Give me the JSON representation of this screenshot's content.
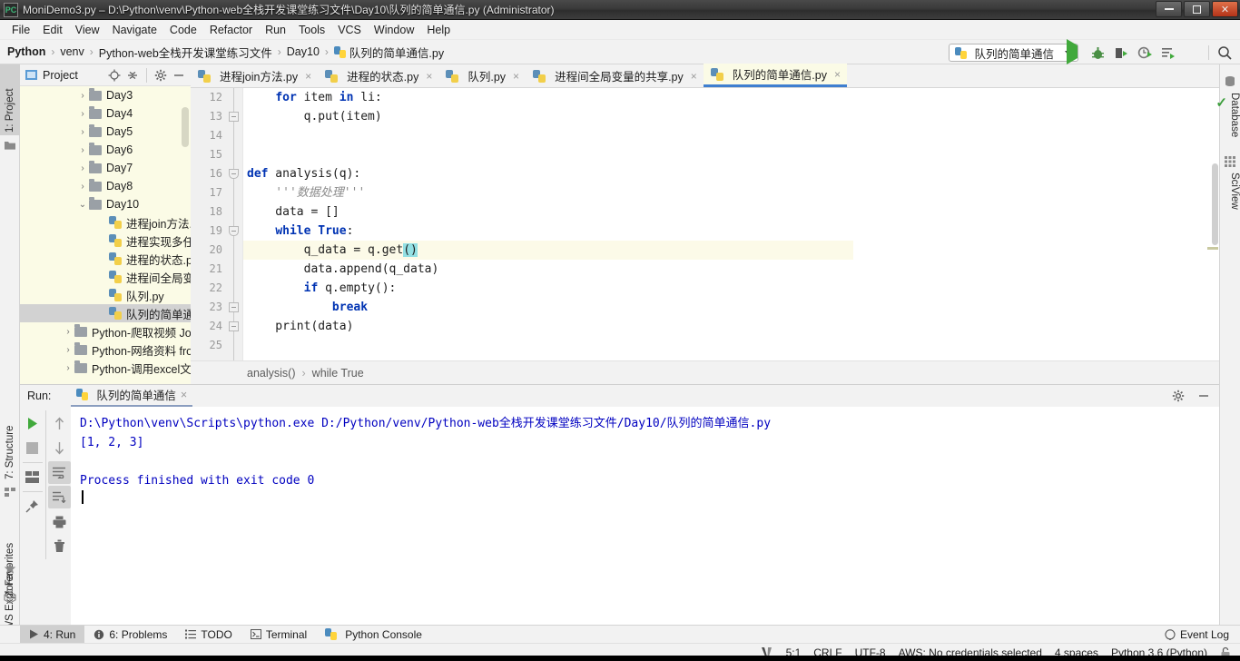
{
  "window": {
    "title": "MoniDemo3.py – D:\\Python\\venv\\Python-web全栈开发课堂练习文件\\Day10\\队列的简单通信.py (Administrator)",
    "app_icon": "PC",
    "minimize": "minimize-icon",
    "restore": "restore-icon",
    "close": "✕"
  },
  "menu": {
    "items": [
      {
        "label": "File"
      },
      {
        "label": "Edit"
      },
      {
        "label": "View"
      },
      {
        "label": "Navigate"
      },
      {
        "label": "Code"
      },
      {
        "label": "Refactor"
      },
      {
        "label": "Run"
      },
      {
        "label": "Tools"
      },
      {
        "label": "VCS"
      },
      {
        "label": "Window"
      },
      {
        "label": "Help"
      }
    ]
  },
  "navbar": {
    "crumbs": [
      "Python",
      "venv",
      "Python-web全栈开发课堂练习文件",
      "Day10",
      "队列的简单通信.py"
    ],
    "separator": "›",
    "run_config": "队列的简单通信",
    "toolbar_icons": [
      "run-icon",
      "debug-icon",
      "run-coverage-icon",
      "profile-icon",
      "run-with-console-icon",
      "stop-icon",
      "search-icon"
    ]
  },
  "project_panel": {
    "title": "Project",
    "header_icons": [
      "locate-icon",
      "collapse-all-icon",
      "settings-icon",
      "hide-icon"
    ],
    "tree": [
      {
        "label": "Day3",
        "type": "folder",
        "indent": 1,
        "arrow": "›",
        "selected": false
      },
      {
        "label": "Day4",
        "type": "folder",
        "indent": 1,
        "arrow": "›",
        "selected": false
      },
      {
        "label": "Day5",
        "type": "folder",
        "indent": 1,
        "arrow": "›",
        "selected": false
      },
      {
        "label": "Day6",
        "type": "folder",
        "indent": 1,
        "arrow": "›",
        "selected": false
      },
      {
        "label": "Day7",
        "type": "folder",
        "indent": 1,
        "arrow": "›",
        "selected": false
      },
      {
        "label": "Day8",
        "type": "folder",
        "indent": 1,
        "arrow": "›",
        "selected": false
      },
      {
        "label": "Day10",
        "type": "folder",
        "indent": 1,
        "arrow": "⌄",
        "selected": false
      },
      {
        "label": "进程join方法.",
        "type": "py",
        "indent": 2,
        "arrow": "",
        "selected": false
      },
      {
        "label": "进程实现多任",
        "type": "py",
        "indent": 2,
        "arrow": "",
        "selected": false
      },
      {
        "label": "进程的状态.py",
        "type": "py",
        "indent": 2,
        "arrow": "",
        "selected": false
      },
      {
        "label": "进程间全局变",
        "type": "py",
        "indent": 2,
        "arrow": "",
        "selected": false
      },
      {
        "label": "队列.py",
        "type": "py",
        "indent": 2,
        "arrow": "",
        "selected": false
      },
      {
        "label": "队列的简单通",
        "type": "py",
        "indent": 2,
        "arrow": "",
        "selected": true
      },
      {
        "label": "Python-爬取视频 Jo",
        "type": "folder",
        "indent": 0,
        "arrow": "›",
        "selected": false
      },
      {
        "label": "Python-网络资料 fro",
        "type": "folder",
        "indent": 0,
        "arrow": "›",
        "selected": false
      },
      {
        "label": "Python-调用excel文",
        "type": "folder",
        "indent": 0,
        "arrow": "›",
        "selected": false
      }
    ]
  },
  "left_strip": {
    "tabs": [
      {
        "label": "1: Project",
        "icon": "project-icon",
        "selected": true
      },
      {
        "label": "7: Structure",
        "icon": "structure-icon",
        "selected": false
      },
      {
        "label": "2: Favorites",
        "icon": "star-icon",
        "selected": false
      },
      {
        "label": "AWS Explorer",
        "icon": "cube-icon",
        "selected": false
      }
    ]
  },
  "right_strip": {
    "tabs": [
      {
        "label": "Database",
        "icon": "database-icon"
      },
      {
        "label": "SciView",
        "icon": "grid-icon"
      }
    ]
  },
  "editor": {
    "tabs": [
      {
        "label": "进程join方法.py",
        "active": false
      },
      {
        "label": "进程的状态.py",
        "active": false
      },
      {
        "label": "队列.py",
        "active": false
      },
      {
        "label": "进程间全局变量的共享.py",
        "active": false
      },
      {
        "label": "队列的简单通信.py",
        "active": true
      }
    ],
    "close_glyph": "×",
    "first_line_number": 12,
    "line_numbers": [
      12,
      13,
      14,
      15,
      16,
      17,
      18,
      19,
      20,
      21,
      22,
      23,
      24,
      25
    ],
    "highlighted_line": 20,
    "code": [
      {
        "n": 12,
        "segments": [
          {
            "t": "    ",
            "c": "pl"
          },
          {
            "t": "for",
            "c": "kw"
          },
          {
            "t": " item ",
            "c": "pl"
          },
          {
            "t": "in",
            "c": "kw"
          },
          {
            "t": " li:",
            "c": "pl"
          }
        ]
      },
      {
        "n": 13,
        "segments": [
          {
            "t": "        q.put(item)",
            "c": "pl"
          }
        ]
      },
      {
        "n": 14,
        "segments": [
          {
            "t": "",
            "c": "pl"
          }
        ]
      },
      {
        "n": 15,
        "segments": [
          {
            "t": "",
            "c": "pl"
          }
        ]
      },
      {
        "n": 16,
        "segments": [
          {
            "t": "def",
            "c": "kw"
          },
          {
            "t": " analysis(q):",
            "c": "pl"
          }
        ]
      },
      {
        "n": 17,
        "segments": [
          {
            "t": "    '''数据处理'''",
            "c": "doc"
          }
        ]
      },
      {
        "n": 18,
        "segments": [
          {
            "t": "    data = []",
            "c": "pl"
          }
        ]
      },
      {
        "n": 19,
        "segments": [
          {
            "t": "    ",
            "c": "pl"
          },
          {
            "t": "while",
            "c": "kw"
          },
          {
            "t": " ",
            "c": "pl"
          },
          {
            "t": "True",
            "c": "kw"
          },
          {
            "t": ":",
            "c": "pl"
          }
        ]
      },
      {
        "n": 20,
        "segments": [
          {
            "t": "        q_data = q.get",
            "c": "pl"
          },
          {
            "t": "()",
            "c": "paren-hl"
          }
        ]
      },
      {
        "n": 21,
        "segments": [
          {
            "t": "        data.append(q_data)",
            "c": "pl"
          }
        ]
      },
      {
        "n": 22,
        "segments": [
          {
            "t": "        ",
            "c": "pl"
          },
          {
            "t": "if",
            "c": "kw"
          },
          {
            "t": " q.empty():",
            "c": "pl"
          }
        ]
      },
      {
        "n": 23,
        "segments": [
          {
            "t": "            ",
            "c": "pl"
          },
          {
            "t": "break",
            "c": "kw"
          }
        ]
      },
      {
        "n": 24,
        "segments": [
          {
            "t": "    print(data)",
            "c": "pl"
          }
        ]
      },
      {
        "n": 25,
        "segments": [
          {
            "t": "",
            "c": "pl"
          }
        ]
      }
    ],
    "inspection_status": "✓",
    "breadcrumb": [
      "analysis()",
      "while True"
    ],
    "breadcrumb_separator": "›"
  },
  "run_panel": {
    "label": "Run:",
    "tab_label": "队列的简单通信",
    "tab_close": "×",
    "settings_icon": "gear-icon",
    "hide_icon": "minimize-icon",
    "side_buttons": [
      "rerun-icon",
      "stop-icon",
      "layout-icon",
      "pin-icon",
      "up-icon",
      "down-icon",
      "soft-wrap-icon",
      "scroll-to-end-icon",
      "print-icon",
      "clear-all-icon"
    ],
    "output": [
      "D:\\Python\\venv\\Scripts\\python.exe D:/Python/venv/Python-web全栈开发课堂练习文件/Day10/队列的简单通信.py",
      "[1, 2, 3]",
      "",
      "Process finished with exit code 0"
    ]
  },
  "bottom_bar": {
    "items": [
      {
        "label": "4: Run",
        "icon": "run-icon",
        "selected": true
      },
      {
        "label": "6: Problems",
        "icon": "problems-icon",
        "selected": false
      },
      {
        "label": "TODO",
        "icon": "todo-icon",
        "selected": false
      },
      {
        "label": "Terminal",
        "icon": "terminal-icon",
        "selected": false
      },
      {
        "label": "Python Console",
        "icon": "python-console-icon",
        "selected": false
      }
    ],
    "event_log": "Event Log",
    "event_log_icon": "balloon-icon"
  },
  "status_bar": {
    "git_icon": "vcs-branch-icon",
    "caret": "5:1",
    "line_separator": "CRLF",
    "encoding": "UTF-8",
    "aws": "AWS: No credentials selected",
    "indent": "4 spaces",
    "interpreter": "Python 3.6 (Python)",
    "lock_icon": "lock-icon"
  },
  "colors": {
    "accent_blue": "#3f7fd0",
    "keyword_blue": "#0033b3",
    "console_blue": "#0000c0",
    "tree_bg": "#fbfbe6",
    "highlight_line": "#fcfae8",
    "paren_match": "#93e0e3",
    "run_green": "#41a93c"
  }
}
